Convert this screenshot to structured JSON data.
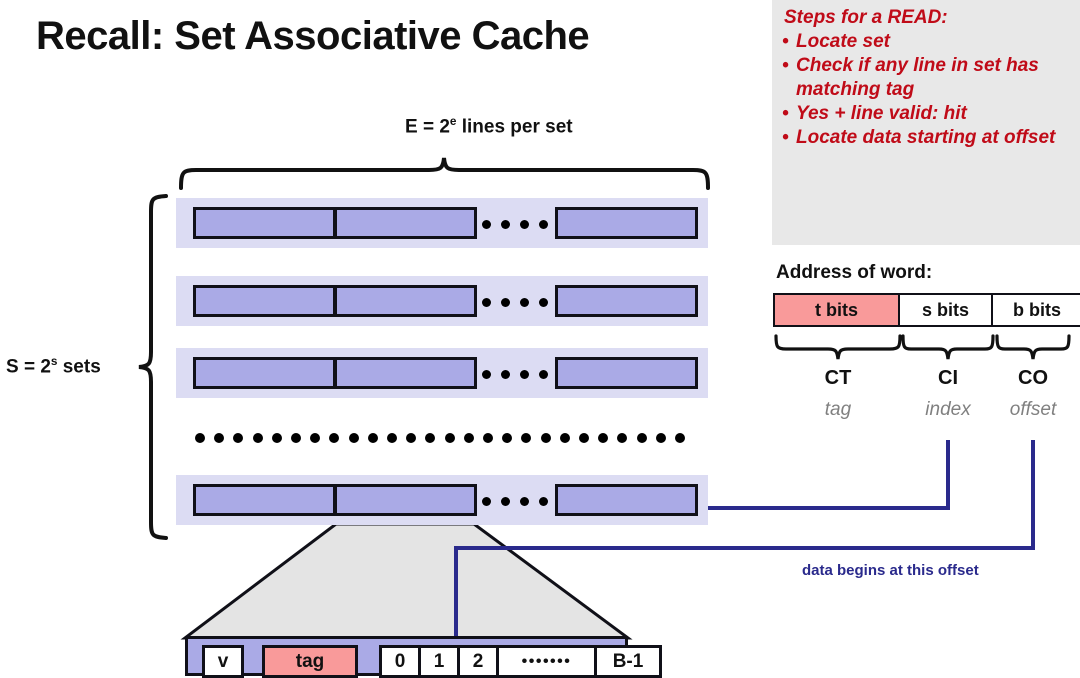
{
  "slide": {
    "title": "Recall: Set Associative Cache"
  },
  "diagram": {
    "e_label_prefix": "E = 2",
    "e_label_sup": "e",
    "e_label_suffix": " lines per set",
    "s_label_prefix": "S = 2",
    "s_label_sup": "s",
    "s_label_suffix": " sets",
    "set_band_count": 4,
    "lines_per_band": 3,
    "horizontal_dots_per_band": 4,
    "vertical_ellipsis_dots": 26
  },
  "cache_line_detail": {
    "valid_cell": "v",
    "tag_cell": "tag",
    "data_cells": [
      "0",
      "1",
      "2",
      "•••••••",
      "B-1"
    ]
  },
  "steps": {
    "title": "Steps for a READ:",
    "items": [
      "Locate set",
      "Check if any line in set has matching tag",
      "Yes + line valid: hit",
      "Locate data starting at offset"
    ]
  },
  "address": {
    "heading": "Address of word:",
    "fields": [
      {
        "label": "t bits",
        "abbrev": "CT",
        "name": "tag"
      },
      {
        "label": "s bits",
        "abbrev": "CI",
        "name": "index"
      },
      {
        "label": "b bits",
        "abbrev": "CO",
        "name": "offset"
      }
    ]
  },
  "annotations": {
    "offset_note": "data begins at this offset"
  },
  "colors": {
    "line_fill": "#aaaae6",
    "set_band": "#dcdcf3",
    "tag_highlight": "#f99a9a",
    "steps_box_bg": "#e8e8e8",
    "steps_text": "#c00b18",
    "arrow_blue": "#2a2a8c",
    "expand_gray": "#e4e4e4"
  }
}
